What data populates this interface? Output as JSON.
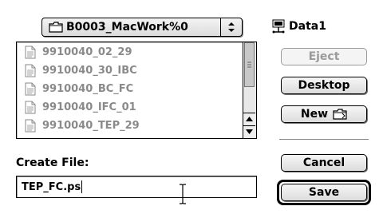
{
  "folder_popup": {
    "label": "B0003_MacWork%0",
    "icon": "folder-icon"
  },
  "disk": {
    "label": "Data1",
    "icon": "network-disk-icon"
  },
  "file_list": {
    "items": [
      {
        "name": "9910040_02_29",
        "icon": "document-icon"
      },
      {
        "name": "9910040_30_IBC",
        "icon": "document-icon"
      },
      {
        "name": "9910040_BC_FC",
        "icon": "document-icon"
      },
      {
        "name": "9910040_IFC_01",
        "icon": "document-icon"
      },
      {
        "name": "9910040_TEP_29",
        "icon": "document-icon"
      }
    ]
  },
  "buttons": {
    "eject": "Eject",
    "desktop": "Desktop",
    "new": "New",
    "cancel": "Cancel",
    "save": "Save"
  },
  "create_file": {
    "label": "Create File:",
    "value": "TEP_FC.ps"
  },
  "colors": {
    "disabled_text": "#8a8a8a",
    "button_face": "#e6e6e6"
  }
}
